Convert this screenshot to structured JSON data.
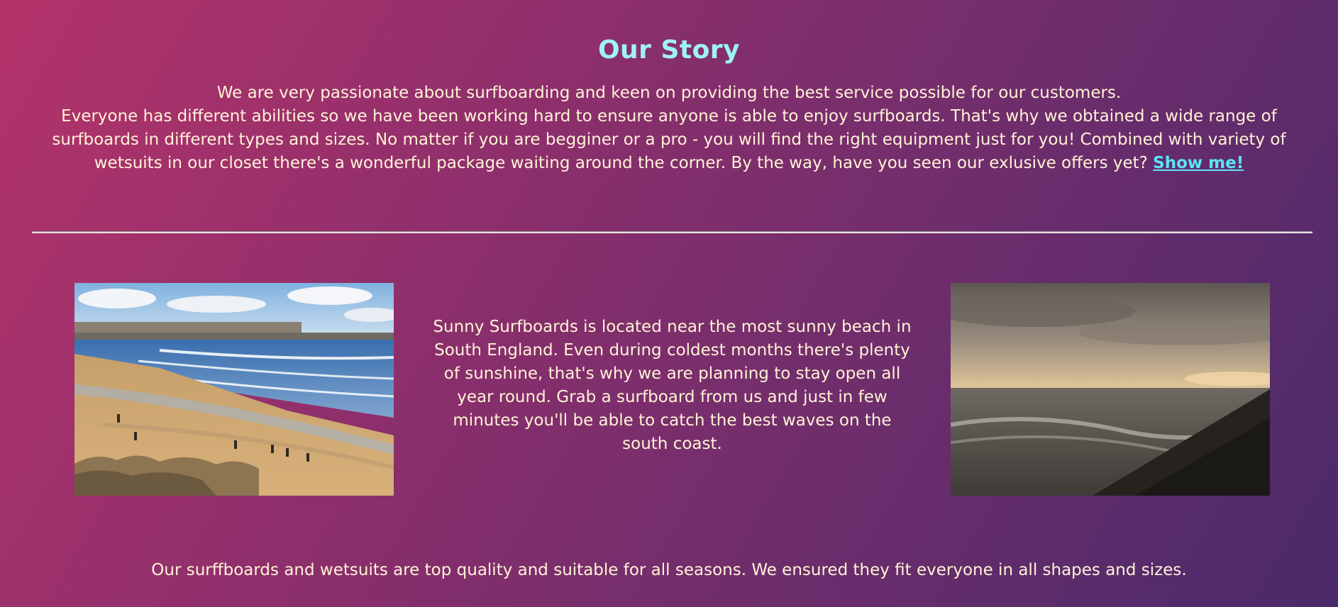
{
  "story": {
    "title": "Our Story",
    "intro_line1": "We are very passionate about surfboarding and keen on providing the best service possible for our customers.",
    "intro_line2": "Everyone has different abilities so we have been working hard to ensure anyone is able to enjoy surfboards. That's why we obtained a wide range of surfboards in different types and sizes. No matter if you are begginer or a pro - you will find the right equipment just for you! Combined with variety of wetsuits in our closet there's a wonderful package waiting around the corner. By the way, have you seen our exlusive offers yet?",
    "link_label": "Show me!"
  },
  "location": {
    "text": "Sunny Surfboards is located near the most sunny beach in South England. Even during coldest months there's plenty of sunshine, that's why we are planning to stay open all year round. Grab a surfboard from us and just in few minutes you'll be able to catch the best waves on the south coast."
  },
  "quality": {
    "text": "Our surffboards and wetsuits are top quality and suitable for all seasons. We ensured they fit everyone in all shapes and sizes."
  },
  "colors": {
    "title": "#9ff3f1",
    "body_text": "#fff3d6",
    "link": "#5de3f5",
    "bg_start": "#b4336a",
    "bg_end": "#4a2a6a"
  }
}
